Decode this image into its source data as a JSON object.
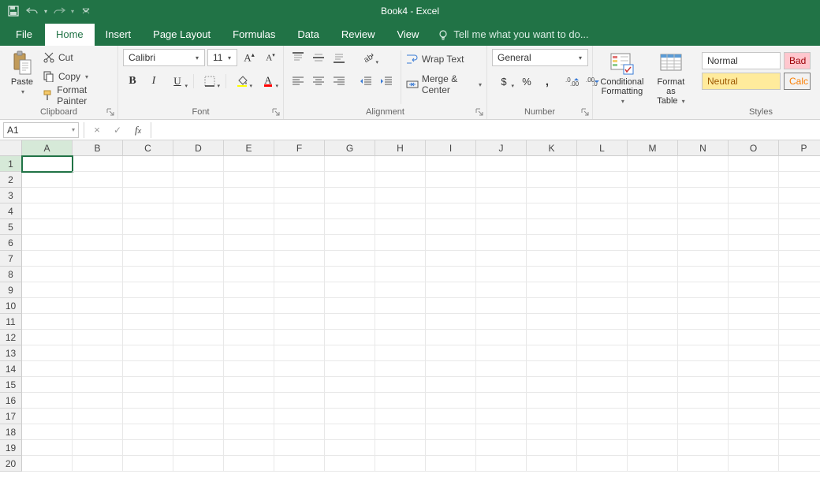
{
  "title": "Book4 - Excel",
  "qat_icons": [
    "save-icon",
    "undo-icon",
    "redo-icon",
    "customize-icon"
  ],
  "tabs": [
    "File",
    "Home",
    "Insert",
    "Page Layout",
    "Formulas",
    "Data",
    "Review",
    "View"
  ],
  "active_tab": "Home",
  "tellme_placeholder": "Tell me what you want to do...",
  "ribbon": {
    "clipboard": {
      "label": "Clipboard",
      "paste": "Paste",
      "cut": "Cut",
      "copy": "Copy",
      "format_painter": "Format Painter"
    },
    "font": {
      "label": "Font",
      "name": "Calibri",
      "size": "11"
    },
    "alignment": {
      "label": "Alignment",
      "wrap": "Wrap Text",
      "merge": "Merge & Center"
    },
    "number": {
      "label": "Number",
      "format": "General"
    },
    "conditional": "Conditional Formatting",
    "format_table": "Format as Table",
    "styles_label": "Styles",
    "styles": {
      "normal": "Normal",
      "bad": "Bad",
      "neutral": "Neutral",
      "calc": "Calc"
    }
  },
  "namebox": "A1",
  "formula": "",
  "columns": [
    "A",
    "B",
    "C",
    "D",
    "E",
    "F",
    "G",
    "H",
    "I",
    "J",
    "K",
    "L",
    "M",
    "N",
    "O",
    "P"
  ],
  "rows": [
    1,
    2,
    3,
    4,
    5,
    6,
    7,
    8,
    9,
    10,
    11,
    12,
    13,
    14,
    15,
    16,
    17,
    18,
    19,
    20
  ],
  "selected_cell": "A1"
}
